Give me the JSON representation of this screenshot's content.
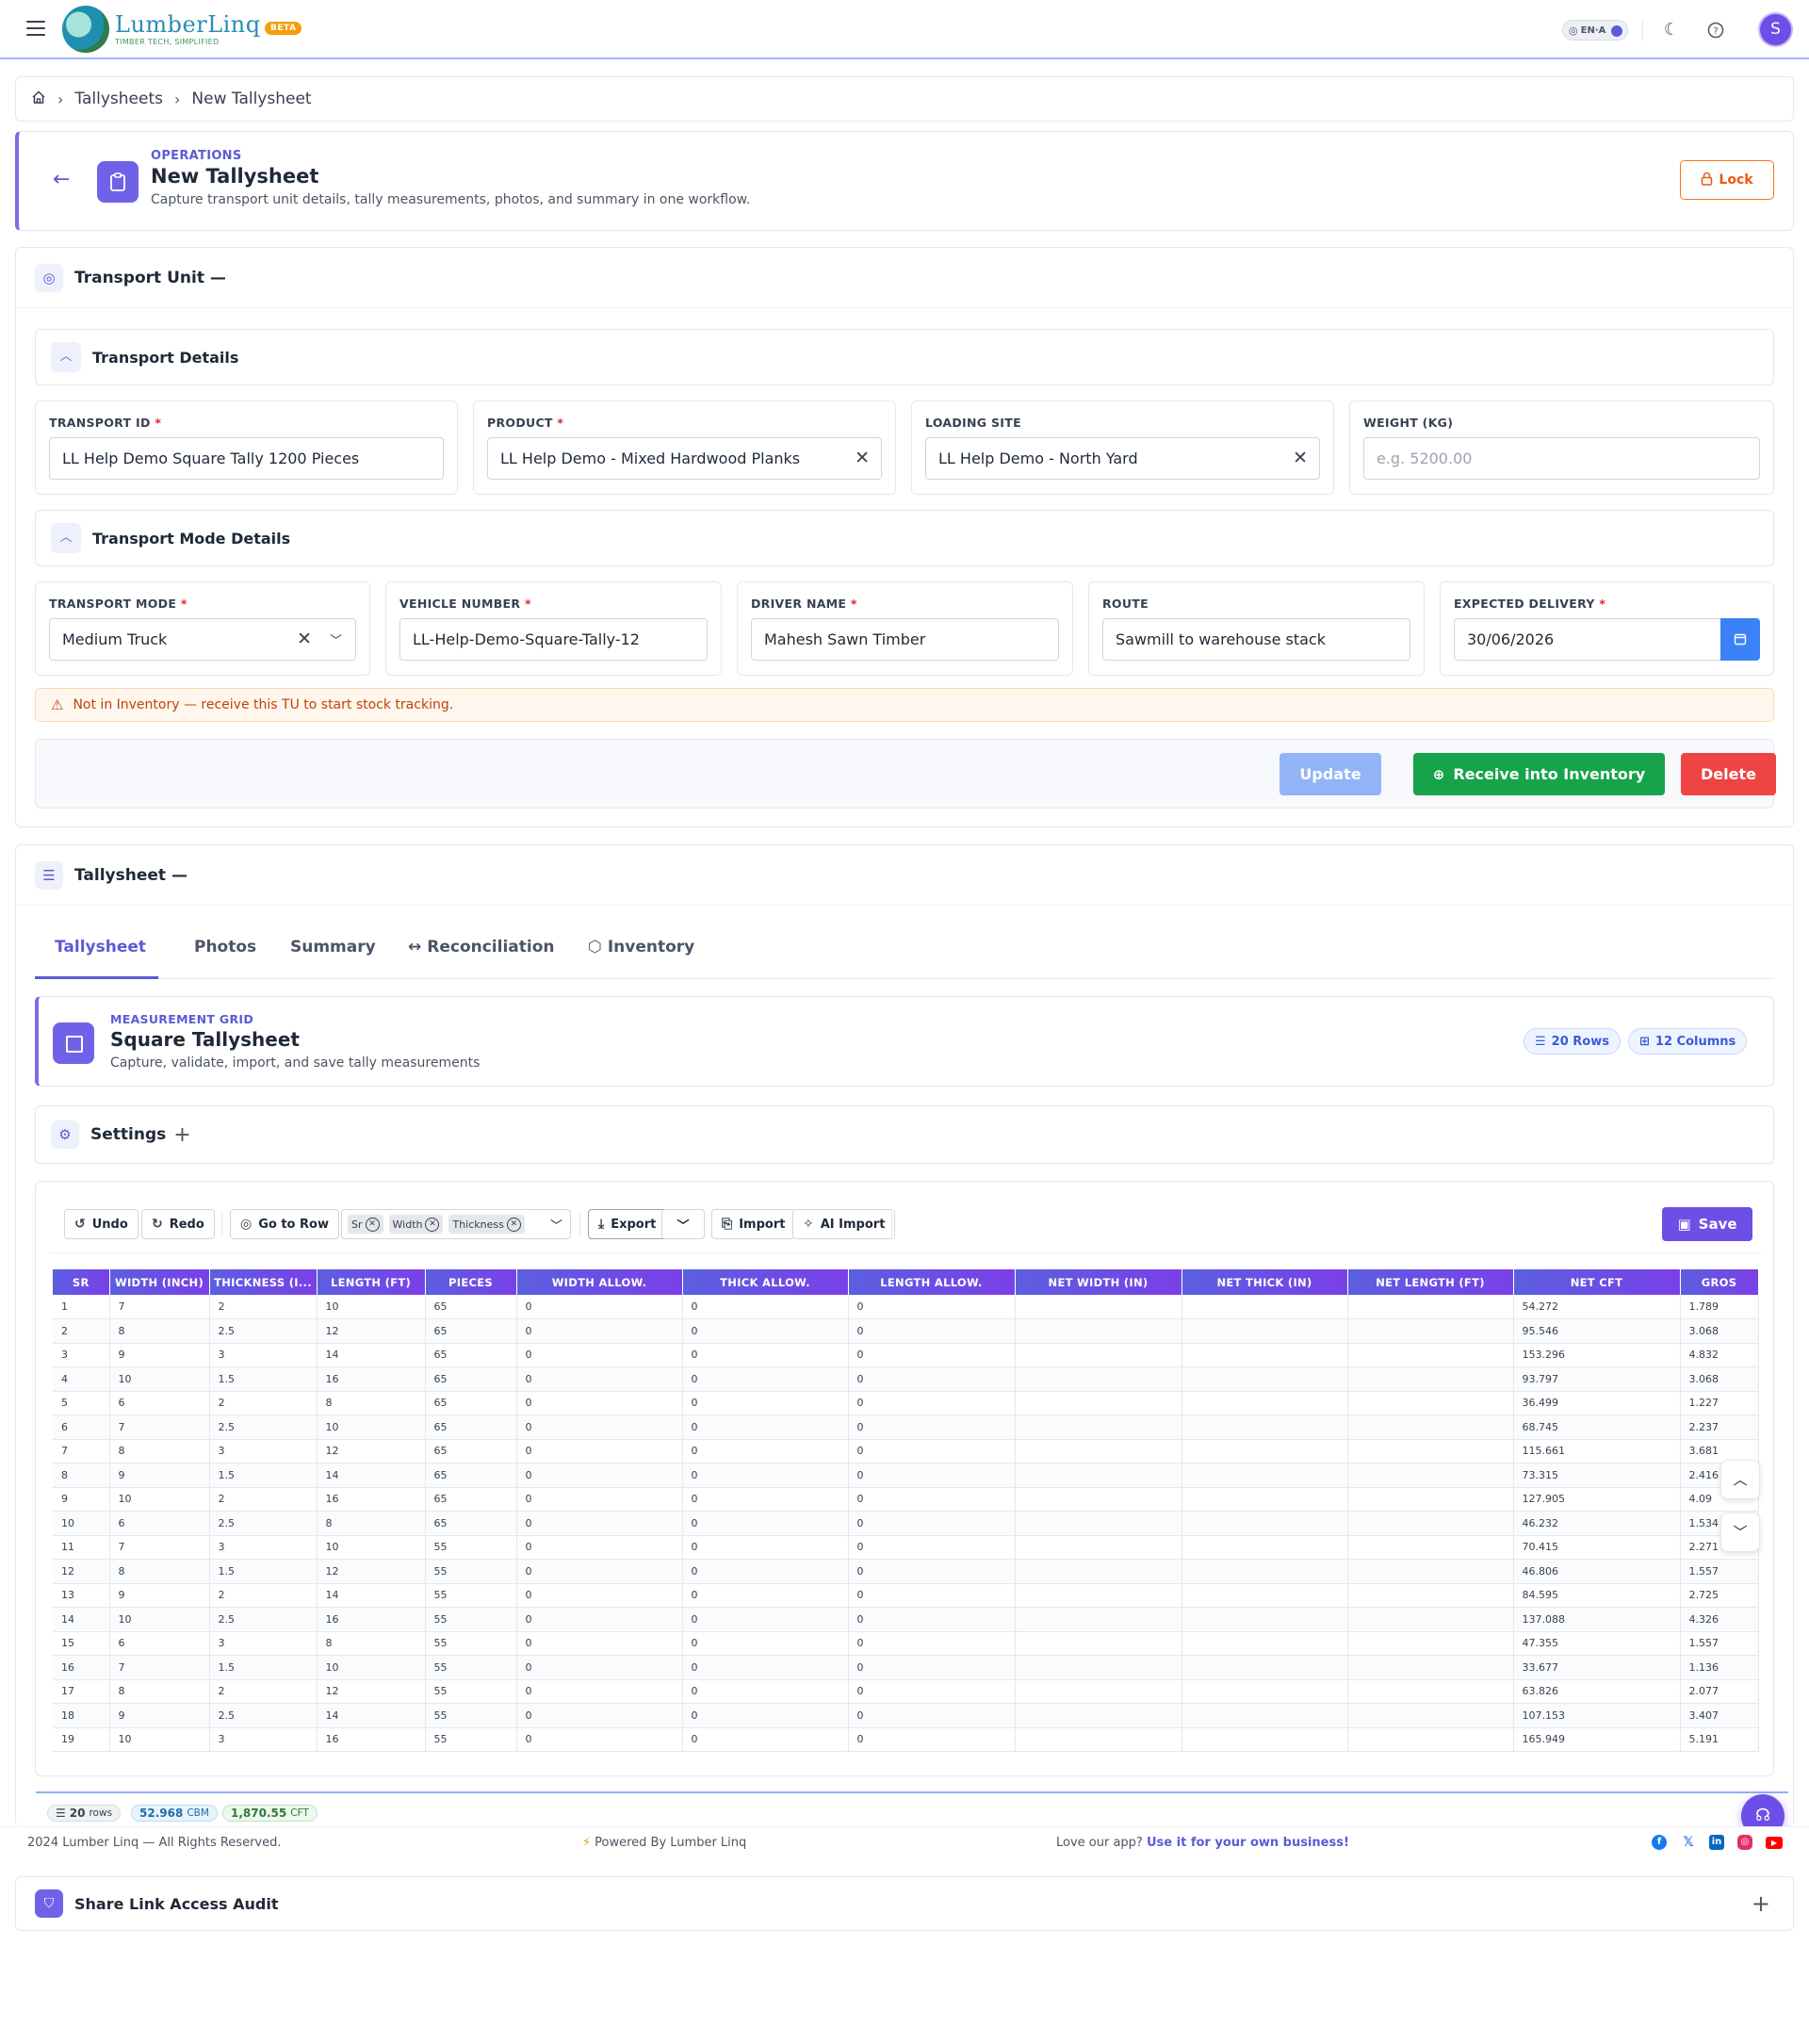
{
  "header": {
    "brand_name": "LumberLinq",
    "brand_tagline": "TIMBER TECH, SIMPLIFIED",
    "beta_label": "BETA",
    "lang_label": "EN·A",
    "avatar_initial": "S"
  },
  "breadcrumb": {
    "items": [
      "Tallysheets",
      "New Tallysheet"
    ]
  },
  "page": {
    "kicker": "OPERATIONS",
    "title": "New Tallysheet",
    "subtitle": "Capture transport unit details, tally measurements, photos, and summary in one workflow.",
    "lock_label": "Lock"
  },
  "transport_unit": {
    "title": "Transport Unit —",
    "details_title": "Transport Details",
    "fields": {
      "transport_id": {
        "label": "TRANSPORT ID",
        "value": "LL Help Demo Square Tally 1200 Pieces"
      },
      "product": {
        "label": "PRODUCT",
        "value": "LL Help Demo - Mixed Hardwood Planks"
      },
      "loading_site": {
        "label": "LOADING SITE",
        "value": "LL Help Demo - North Yard"
      },
      "weight": {
        "label": "WEIGHT (KG)",
        "placeholder": "e.g. 5200.00"
      }
    },
    "mode_title": "Transport Mode Details",
    "mode_fields": {
      "transport_mode": {
        "label": "TRANSPORT MODE",
        "value": "Medium Truck"
      },
      "vehicle_number": {
        "label": "VEHICLE NUMBER",
        "value": "LL-Help-Demo-Square-Tally-12"
      },
      "driver_name": {
        "label": "DRIVER NAME",
        "value": "Mahesh Sawn Timber"
      },
      "route": {
        "label": "ROUTE",
        "value": "Sawmill to warehouse stack"
      },
      "expected_delivery": {
        "label": "EXPECTED DELIVERY",
        "value": "30/06/2026"
      }
    },
    "alert": "Not in Inventory — receive this TU to start stock tracking.",
    "actions": {
      "update": "Update",
      "receive": "Receive into Inventory",
      "delete": "Delete"
    }
  },
  "tallysheet": {
    "title": "Tallysheet —",
    "tabs": [
      "Tallysheet",
      "Photos",
      "Summary",
      "Reconciliation",
      "Inventory"
    ],
    "grid": {
      "kicker": "MEASUREMENT GRID",
      "title": "Square Tallysheet",
      "subtitle": "Capture, validate, import, and save tally measurements",
      "rows_pill": "20 Rows",
      "cols_pill": "12 Columns"
    },
    "settings_title": "Settings",
    "toolbar": {
      "undo": "Undo",
      "redo": "Redo",
      "go_to_row": "Go to Row",
      "chips": [
        "Sr",
        "Width",
        "Thickness"
      ],
      "export": "Export",
      "import": "Import",
      "ai_import": "AI Import",
      "save": "Save"
    },
    "columns": [
      "SR",
      "WIDTH (INCH)",
      "THICKNESS (I...",
      "LENGTH (FT)",
      "PIECES",
      "WIDTH ALLOW.",
      "THICK ALLOW.",
      "LENGTH ALLOW.",
      "NET WIDTH (IN)",
      "NET THICK (IN)",
      "NET LENGTH (FT)",
      "NET CFT",
      "GROS"
    ],
    "rows": [
      [
        "1",
        "7",
        "2",
        "10",
        "65",
        "0",
        "0",
        "0",
        "",
        "",
        "",
        "54.272",
        "1.789"
      ],
      [
        "2",
        "8",
        "2.5",
        "12",
        "65",
        "0",
        "0",
        "0",
        "",
        "",
        "",
        "95.546",
        "3.068"
      ],
      [
        "3",
        "9",
        "3",
        "14",
        "65",
        "0",
        "0",
        "0",
        "",
        "",
        "",
        "153.296",
        "4.832"
      ],
      [
        "4",
        "10",
        "1.5",
        "16",
        "65",
        "0",
        "0",
        "0",
        "",
        "",
        "",
        "93.797",
        "3.068"
      ],
      [
        "5",
        "6",
        "2",
        "8",
        "65",
        "0",
        "0",
        "0",
        "",
        "",
        "",
        "36.499",
        "1.227"
      ],
      [
        "6",
        "7",
        "2.5",
        "10",
        "65",
        "0",
        "0",
        "0",
        "",
        "",
        "",
        "68.745",
        "2.237"
      ],
      [
        "7",
        "8",
        "3",
        "12",
        "65",
        "0",
        "0",
        "0",
        "",
        "",
        "",
        "115.661",
        "3.681"
      ],
      [
        "8",
        "9",
        "1.5",
        "14",
        "65",
        "0",
        "0",
        "0",
        "",
        "",
        "",
        "73.315",
        "2.416"
      ],
      [
        "9",
        "10",
        "2",
        "16",
        "65",
        "0",
        "0",
        "0",
        "",
        "",
        "",
        "127.905",
        "4.09"
      ],
      [
        "10",
        "6",
        "2.5",
        "8",
        "65",
        "0",
        "0",
        "0",
        "",
        "",
        "",
        "46.232",
        "1.534"
      ],
      [
        "11",
        "7",
        "3",
        "10",
        "55",
        "0",
        "0",
        "0",
        "",
        "",
        "",
        "70.415",
        "2.271"
      ],
      [
        "12",
        "8",
        "1.5",
        "12",
        "55",
        "0",
        "0",
        "0",
        "",
        "",
        "",
        "46.806",
        "1.557"
      ],
      [
        "13",
        "9",
        "2",
        "14",
        "55",
        "0",
        "0",
        "0",
        "",
        "",
        "",
        "84.595",
        "2.725"
      ],
      [
        "14",
        "10",
        "2.5",
        "16",
        "55",
        "0",
        "0",
        "0",
        "",
        "",
        "",
        "137.088",
        "4.326"
      ],
      [
        "15",
        "6",
        "3",
        "8",
        "55",
        "0",
        "0",
        "0",
        "",
        "",
        "",
        "47.355",
        "1.557"
      ],
      [
        "16",
        "7",
        "1.5",
        "10",
        "55",
        "0",
        "0",
        "0",
        "",
        "",
        "",
        "33.677",
        "1.136"
      ],
      [
        "17",
        "8",
        "2",
        "12",
        "55",
        "0",
        "0",
        "0",
        "",
        "",
        "",
        "63.826",
        "2.077"
      ],
      [
        "18",
        "9",
        "2.5",
        "14",
        "55",
        "0",
        "0",
        "0",
        "",
        "",
        "",
        "107.153",
        "3.407"
      ],
      [
        "19",
        "10",
        "3",
        "16",
        "55",
        "0",
        "0",
        "0",
        "",
        "",
        "",
        "165.949",
        "5.191"
      ]
    ],
    "status": {
      "rows": "20",
      "rows_unit": "rows",
      "cbm": "52.968",
      "cbm_unit": "CBM",
      "cft": "1,870.55",
      "cft_unit": "CFT"
    }
  },
  "footer": {
    "copyright": "2024 Lumber Linq — All Rights Reserved.",
    "powered": "Powered By Lumber Linq",
    "promo_text": "Love our app?",
    "promo_link": "Use it for your own business!"
  },
  "audit": {
    "title": "Share Link Access Audit"
  },
  "colors": {
    "accent": "#5b5bd6",
    "brand_purple": "#6d4ee6",
    "success": "#16a34a",
    "danger": "#ef4444",
    "warning": "#ea580c"
  }
}
